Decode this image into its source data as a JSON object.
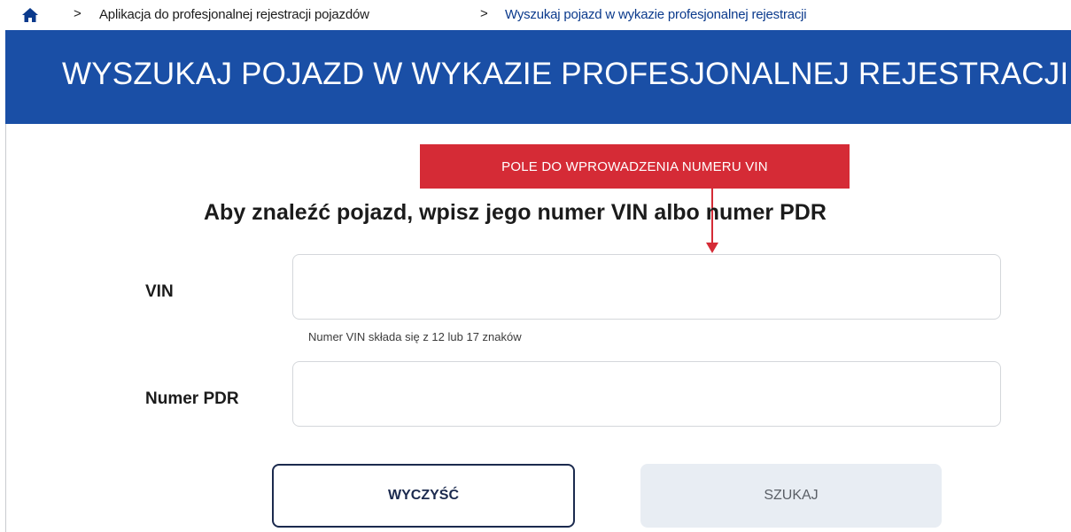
{
  "breadcrumb": {
    "home_icon": "home-icon",
    "separator": ">",
    "items": [
      {
        "label": "Aplikacja do profesjonalnej rejestracji pojazdów"
      },
      {
        "label": "Wyszukaj pojazd w wykazie profesjonalnej rejestracji"
      }
    ]
  },
  "banner": {
    "title": "WYSZUKAJ POJAZD W WYKAZIE PROFESJONALNEJ REJESTRACJI",
    "color": "#1a4fa6"
  },
  "annotation": {
    "label": "POLE DO WPROWADZENIA NUMERU VIN",
    "color": "#d52b36"
  },
  "form": {
    "heading": "Aby znaleźć pojazd, wpisz jego numer VIN albo numer PDR",
    "vin": {
      "label": "VIN",
      "value": "",
      "hint": "Numer VIN składa się z 12 lub 17 znaków"
    },
    "pdr": {
      "label": "Numer PDR",
      "value": ""
    },
    "buttons": {
      "clear_label": "WYCZYŚĆ",
      "search_label": "SZUKAJ"
    }
  }
}
